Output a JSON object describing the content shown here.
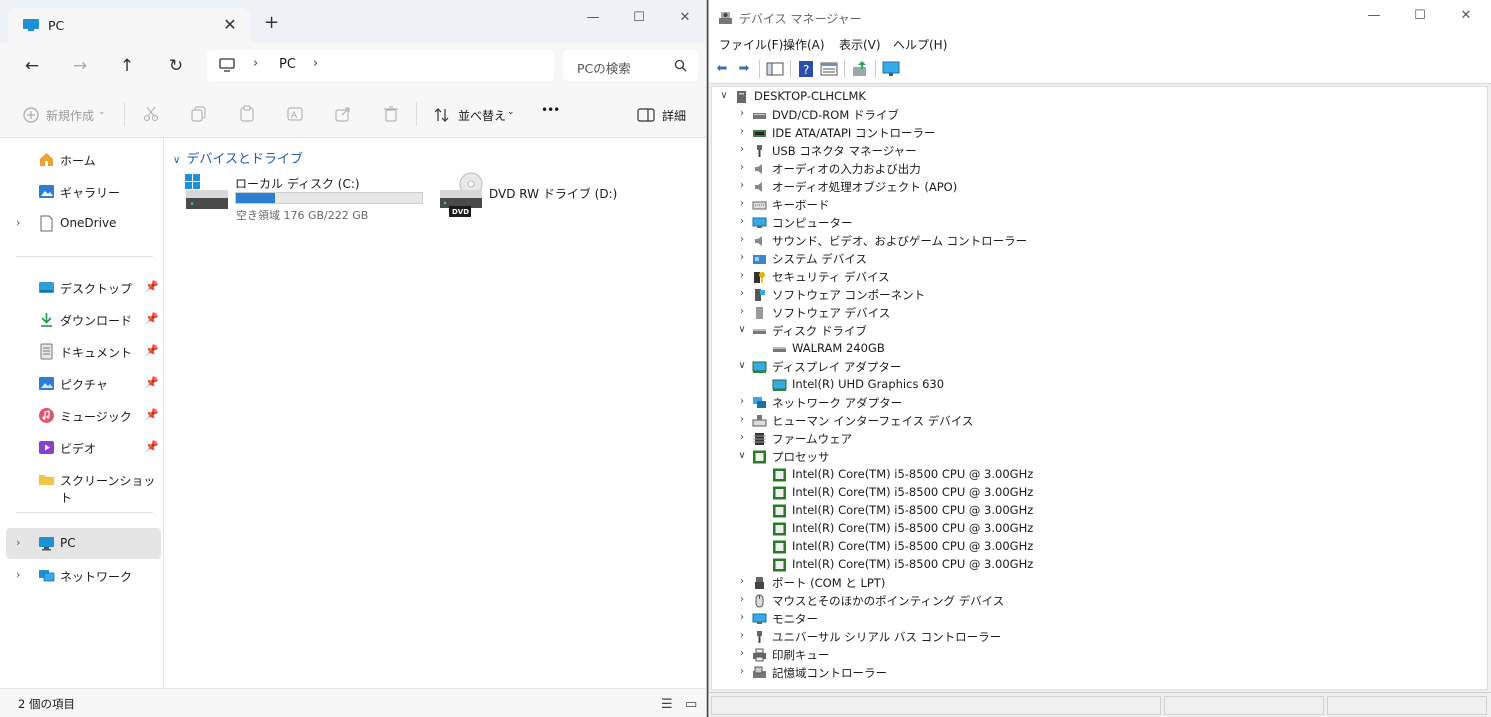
{
  "explorer": {
    "tab_title": "PC",
    "new_tab": "+",
    "close_tab": "✕",
    "window_controls": {
      "minimize": "—",
      "maximize": "☐",
      "close": "✕"
    },
    "nav": {
      "back": "←",
      "forward": "→",
      "up": "↑",
      "refresh": "↻"
    },
    "breadcrumb": {
      "sep": "›",
      "item": "PC",
      "sep2": "›"
    },
    "search_placeholder": "PCの検索",
    "toolbar": {
      "new": "新規作成",
      "sort": "並べ替え",
      "more": "•••",
      "details": "詳細"
    },
    "sidebar": {
      "home": "ホーム",
      "gallery": "ギャラリー",
      "onedrive": "OneDrive",
      "desktop": "デスクトップ",
      "downloads": "ダウンロード",
      "documents": "ドキュメント",
      "pictures": "ピクチャ",
      "music": "ミュージック",
      "videos": "ビデオ",
      "screenshots": "スクリーンショット",
      "pc": "PC",
      "network": "ネットワーク"
    },
    "section_title": "デバイスとドライブ",
    "drives": {
      "c_name": "ローカル ディスク (C:)",
      "c_space": "空き領域 176 GB/222 GB",
      "c_used_fraction": 0.21,
      "d_name": "DVD RW ドライブ (D:)",
      "d_badge": "DVD"
    },
    "status_count": "2 個の項目"
  },
  "devmgr": {
    "title": "デバイス マネージャー",
    "window_controls": {
      "minimize": "—",
      "maximize": "☐",
      "close": "✕"
    },
    "menu": {
      "file": "ファイル(F)",
      "action": "操作(A)",
      "view": "表示(V)",
      "help": "ヘルプ(H)"
    },
    "tree": {
      "root": "DESKTOP-CLHCLMK",
      "dvd": "DVD/CD-ROM ドライブ",
      "ide": "IDE ATA/ATAPI コントローラー",
      "usb_conn": "USB コネクタ マネージャー",
      "audio_io": "オーディオの入力および出力",
      "apo": "オーディオ処理オブジェクト (APO)",
      "keyboard": "キーボード",
      "computer": "コンピューター",
      "sound": "サウンド、ビデオ、およびゲーム コントローラー",
      "system": "システム デバイス",
      "security": "セキュリティ デバイス",
      "sw_component": "ソフトウェア コンポーネント",
      "sw_device": "ソフトウェア デバイス",
      "disk": "ディスク ドライブ",
      "disk_child": "WALRAM 240GB",
      "display": "ディスプレイ アダプター",
      "display_child": "Intel(R) UHD Graphics 630",
      "network": "ネットワーク アダプター",
      "hid": "ヒューマン インターフェイス デバイス",
      "firmware": "ファームウェア",
      "processor": "プロセッサ",
      "cpu": "Intel(R) Core(TM) i5-8500 CPU @ 3.00GHz",
      "ports": "ポート (COM と LPT)",
      "mouse": "マウスとそのほかのポインティング デバイス",
      "monitor": "モニター",
      "usb_ctrl": "ユニバーサル シリアル バス コントローラー",
      "print": "印刷キュー",
      "storage": "記憶域コントローラー"
    },
    "expander_open": "∨",
    "expander_closed": "›"
  }
}
